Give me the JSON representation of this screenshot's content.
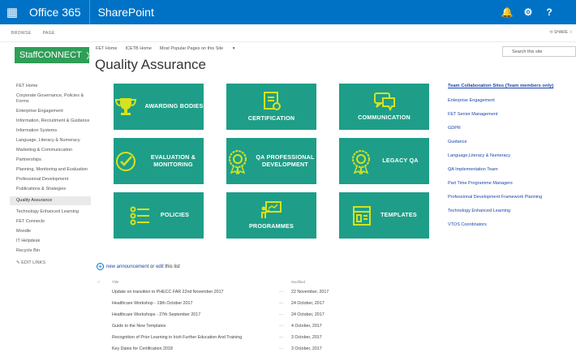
{
  "suite": {
    "app_name": "Office 365",
    "site_name": "SharePoint",
    "help": "?"
  },
  "ribbon": {
    "tabs": [
      "BROWSE",
      "PAGE"
    ],
    "share": "SHARE"
  },
  "logo": {
    "text": "StaffCONNECT"
  },
  "breadcrumb": [
    "FET Home",
    "ICETB Home",
    "Most Popular Pages on this Site"
  ],
  "page_title": "Quality Assurance",
  "search": {
    "placeholder": "Search this site"
  },
  "nav": {
    "items": [
      "FET Home",
      "Corporate Governance, Policies & Forms",
      "Enterprise Engagement",
      "Information, Recruitment & Guidance",
      "Information Systems",
      "Language, Literacy & Numeracy",
      "Marketing & Communication",
      "Partnerships",
      "Planning, Monitoring and Evaluation",
      "Professional Development",
      "Publications & Strategies",
      "Quality Assurance",
      "Technology Enhanced Learning",
      "FET Connects",
      "Moodle",
      "IT Helpdesk",
      "Recycle Bin"
    ],
    "edit_links": "EDIT LINKS"
  },
  "tiles": [
    {
      "label": "AWARDING BODIES",
      "icon": "trophy-icon"
    },
    {
      "label": "CERTIFICATION",
      "icon": "certificate-icon"
    },
    {
      "label": "COMMUNICATION",
      "icon": "chat-icon"
    },
    {
      "label": "EVALUATION & MONITORING",
      "icon": "check-circle-icon"
    },
    {
      "label": "QA PROFESSIONAL DEVELOPMENT",
      "icon": "badge-icon"
    },
    {
      "label": "LEGACY QA",
      "icon": "medal-icon"
    },
    {
      "label": "POLICIES",
      "icon": "list-icon"
    },
    {
      "label": "PROGRAMMES",
      "icon": "presentation-icon"
    },
    {
      "label": "TEMPLATES",
      "icon": "template-icon"
    }
  ],
  "links": {
    "heading": "Team Collaboration Sites (Team members only)",
    "items": [
      "Enterprise Engagement",
      "FET Senior Management",
      "GDPR",
      "Guidance",
      "Language,Literacy & Numeracy",
      "QA Implementation Team",
      "Part Time Programme Managers",
      "Professional Development Framework Planning",
      "Technology Enhanced Learning",
      "VTOS Coordinators"
    ]
  },
  "announcements": {
    "new_label": "new announcement",
    "or_label": "or",
    "edit_label": "edit",
    "this_list": "this list",
    "col_title": "Title",
    "col_modified": "Modified",
    "rows": [
      {
        "title": "Update on transition to PHECC FAR 22nd November 2017",
        "modified": "22 November, 2017"
      },
      {
        "title": "Healthcare Workshop - 19th October 2017",
        "modified": "24 October, 2017"
      },
      {
        "title": "Healthcare Workshops - 27th September 2017",
        "modified": "24 October, 2017"
      },
      {
        "title": "Guide to the New Templates",
        "modified": "4 October, 2017"
      },
      {
        "title": "Recognition of Prior Learning in Irish Further Education And Training",
        "modified": "3 October, 2017"
      },
      {
        "title": "Key Dates for Certification 2018",
        "modified": "3 October, 2017"
      }
    ]
  },
  "colors": {
    "suite_bar": "#0072c6",
    "tile": "#1e9e88",
    "logo": "#2f9e57",
    "link": "#1a46a8"
  }
}
